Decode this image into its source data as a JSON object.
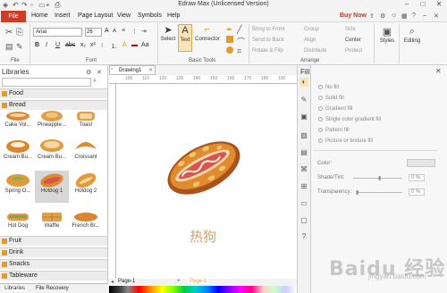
{
  "app": {
    "title": "Edraw Max (Unlicensed Version)"
  },
  "menu": {
    "file": "File",
    "items": [
      "Home",
      "Insert",
      "Page Layout",
      "View",
      "Symbols",
      "Help"
    ],
    "buy_now": "Buy Now"
  },
  "ribbon": {
    "groups": {
      "file": "File",
      "font": "Font",
      "basic_tools": "Basic Tools",
      "arrange": "Arrange",
      "styles": "Styles",
      "editing": "Editing"
    },
    "font_family": "Arial",
    "font_size": "26",
    "select": "Select",
    "text": "Text",
    "connector": "Connector",
    "arrange_items": {
      "bring_to_front": "Bring to Front",
      "send_to_back": "Send to Back",
      "rotate_flip": "Rotate & Flip",
      "group": "Group",
      "align": "Align",
      "distribute": "Distribute",
      "size": "Size",
      "center": "Center",
      "protect": "Protect"
    }
  },
  "libraries": {
    "title": "Libraries",
    "open_category": "Food",
    "sub_category": "Bread",
    "items": [
      [
        "Cake Vol...",
        "Pineapple...",
        "Toast"
      ],
      [
        "Cream Bu...",
        "Cream Bu...",
        "Croissant"
      ],
      [
        "Spring O...",
        "Hotdog 1",
        "Hotdog 2"
      ],
      [
        "Hot Dog",
        "Waffle",
        "French Br..."
      ]
    ],
    "categories": [
      "Fruit",
      "Drink",
      "Snacks",
      "Tableware"
    ],
    "bottom_tabs": [
      "Libraries",
      "File Recovery"
    ]
  },
  "canvas": {
    "tab": "Drawing1",
    "ruler_ticks": [
      "100",
      "110",
      "120",
      "130",
      "140",
      "150",
      "160",
      "170",
      "180",
      "190",
      "200"
    ],
    "shape_label": "热狗",
    "pages": [
      "Page-1",
      "Page-1"
    ]
  },
  "fill": {
    "title": "Fill",
    "options": [
      "No fill",
      "Solid fill",
      "Gradient fill",
      "Single color gradient fill",
      "Pattern fill",
      "Picture or texture fill"
    ],
    "color_label": "Color:",
    "shade_label": "Shade/Tint:",
    "shade_value": "0 %",
    "transparency_label": "Transparency:",
    "transparency_value": "0 %"
  },
  "watermark": {
    "text": "Baidu 经验",
    "sub": "jingyan.baidu.com"
  },
  "colors": {
    "file_red": "#cf3b23",
    "accent_orange": "#e59a2c",
    "hotdog_red": "#d9534f",
    "bun": "#e08c2e"
  }
}
